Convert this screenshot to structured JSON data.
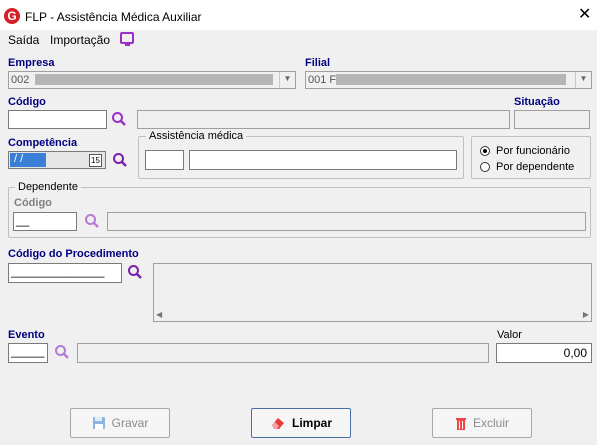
{
  "window": {
    "title": "FLP - Assistência Médica Auxiliar",
    "close_glyph": "✕"
  },
  "menu": {
    "saida": "Saída",
    "importacao": "Importação"
  },
  "empresa": {
    "label": "Empresa",
    "value": "002"
  },
  "filial": {
    "label": "Filial",
    "value": "001 F"
  },
  "codigo": {
    "label": "Código",
    "value": "",
    "description": ""
  },
  "situacao": {
    "label": "Situação",
    "value": ""
  },
  "competencia": {
    "label": "Competência",
    "value": " / /",
    "cal_glyph": "15"
  },
  "assistencia": {
    "title": "Assistência médica",
    "code": "",
    "description": ""
  },
  "tipo": {
    "por_funcionario": "Por funcionário",
    "por_dependente": "Por dependente",
    "selected": "Por funcionário"
  },
  "dependente": {
    "title": "Dependente",
    "codigo_label": "Código",
    "value": "__",
    "description": ""
  },
  "procedimento": {
    "label": "Código do Procedimento",
    "value": "______________"
  },
  "evento": {
    "label": "Evento",
    "value": "_____",
    "description": ""
  },
  "valor": {
    "label": "Valor",
    "value": "0,00"
  },
  "buttons": {
    "gravar": "Gravar",
    "limpar": "Limpar",
    "excluir": "Excluir"
  },
  "colors": {
    "accent": "#9b30c8",
    "label_blue": "#000080",
    "brand_red": "#d61f26"
  }
}
